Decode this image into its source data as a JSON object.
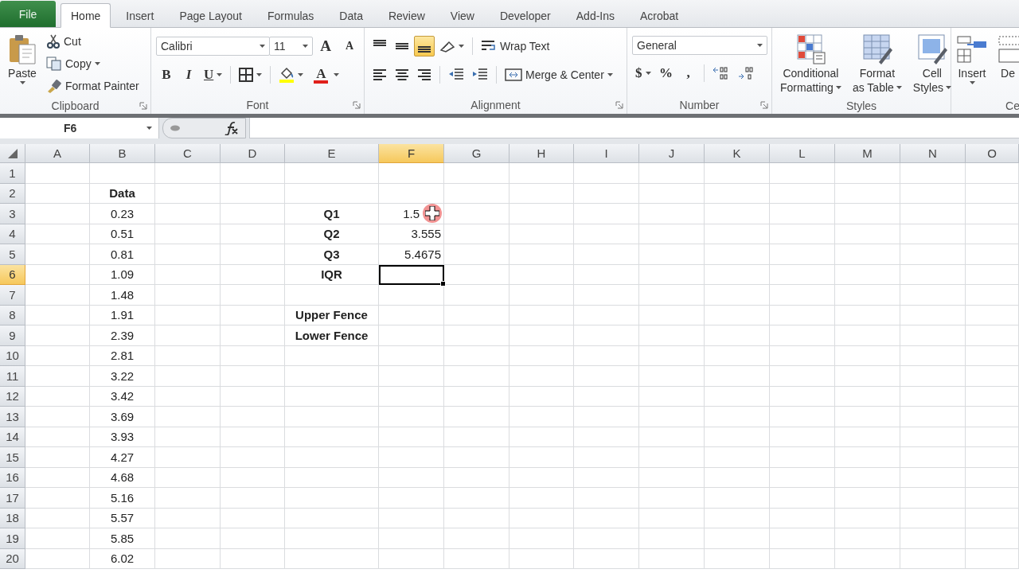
{
  "tabs": [
    {
      "label": "File",
      "kind": "file",
      "selected": false
    },
    {
      "label": "Home",
      "kind": "tab",
      "selected": true
    },
    {
      "label": "Insert",
      "kind": "tab",
      "selected": false
    },
    {
      "label": "Page Layout",
      "kind": "tab",
      "selected": false
    },
    {
      "label": "Formulas",
      "kind": "tab",
      "selected": false
    },
    {
      "label": "Data",
      "kind": "tab",
      "selected": false
    },
    {
      "label": "Review",
      "kind": "tab",
      "selected": false
    },
    {
      "label": "View",
      "kind": "tab",
      "selected": false
    },
    {
      "label": "Developer",
      "kind": "tab",
      "selected": false
    },
    {
      "label": "Add-Ins",
      "kind": "tab",
      "selected": false
    },
    {
      "label": "Acrobat",
      "kind": "tab",
      "selected": false
    }
  ],
  "ribbon": {
    "clipboard": {
      "label": "Clipboard",
      "paste": "Paste",
      "cut": "Cut",
      "copy": "Copy",
      "format_painter": "Format Painter"
    },
    "font": {
      "label": "Font",
      "font_name": "Calibri",
      "font_size": "11",
      "grow_glyph": "A",
      "shrink_glyph": "A",
      "bold_glyph": "B",
      "italic_glyph": "I",
      "underline_glyph": "U",
      "font_color_glyph": "A"
    },
    "alignment": {
      "label": "Alignment",
      "vertical": [
        {
          "kind": "top",
          "selected": false
        },
        {
          "kind": "middle",
          "selected": false
        },
        {
          "kind": "bottom",
          "selected": true
        }
      ],
      "horizontal": [
        {
          "kind": "left",
          "selected": false
        },
        {
          "kind": "center",
          "selected": false
        },
        {
          "kind": "right",
          "selected": false
        }
      ],
      "wrap_text": "Wrap Text",
      "merge_center": "Merge & Center"
    },
    "number": {
      "label": "Number",
      "format": "General",
      "currency": "$",
      "percent": "%",
      "comma": ","
    },
    "styles": {
      "label": "Styles",
      "buttons": [
        {
          "kind": "conditional",
          "lines": [
            "Conditional",
            "Formatting"
          ]
        },
        {
          "kind": "table",
          "lines": [
            "Format",
            "as Table"
          ]
        },
        {
          "kind": "cell",
          "lines": [
            "Cell",
            "Styles"
          ]
        }
      ]
    },
    "cells": {
      "label": "Ce",
      "buttons": [
        {
          "kind": "insert",
          "lines": [
            "Insert"
          ]
        },
        {
          "kind": "delete",
          "lines": [
            "De"
          ]
        }
      ]
    }
  },
  "name_box": "F6",
  "sheet": {
    "columns": [
      {
        "label": "A",
        "selected": false
      },
      {
        "label": "B",
        "selected": false
      },
      {
        "label": "C",
        "selected": false
      },
      {
        "label": "D",
        "selected": false
      },
      {
        "label": "E",
        "selected": false
      },
      {
        "label": "F",
        "selected": true
      },
      {
        "label": "G",
        "selected": false
      },
      {
        "label": "H",
        "selected": false
      },
      {
        "label": "I",
        "selected": false
      },
      {
        "label": "J",
        "selected": false
      },
      {
        "label": "K",
        "selected": false
      },
      {
        "label": "L",
        "selected": false
      },
      {
        "label": "M",
        "selected": false
      },
      {
        "label": "N",
        "selected": false
      },
      {
        "label": "O",
        "selected": false
      }
    ],
    "rows": [
      {
        "label": "1",
        "selected": false
      },
      {
        "label": "2",
        "selected": false,
        "cells": {
          "b": {
            "text": "Data",
            "bold": true,
            "selected": false
          }
        }
      },
      {
        "label": "3",
        "selected": false,
        "cells": {
          "b": {
            "text": "0.23",
            "bold": false,
            "selected": false
          },
          "e": {
            "text": "Q1",
            "bold": true,
            "selected": false
          },
          "f": {
            "text": "1.5",
            "bold": false,
            "selected": false,
            "pointer": true
          }
        }
      },
      {
        "label": "4",
        "selected": false,
        "cells": {
          "b": {
            "text": "0.51",
            "bold": false,
            "selected": false
          },
          "e": {
            "text": "Q2",
            "bold": true,
            "selected": false
          },
          "f": {
            "text": "3.555",
            "bold": false,
            "selected": false
          }
        }
      },
      {
        "label": "5",
        "selected": false,
        "cells": {
          "b": {
            "text": "0.81",
            "bold": false,
            "selected": false
          },
          "e": {
            "text": "Q3",
            "bold": true,
            "selected": false
          },
          "f": {
            "text": "5.4675",
            "bold": false,
            "selected": false
          }
        }
      },
      {
        "label": "6",
        "selected": true,
        "cells": {
          "b": {
            "text": "1.09",
            "bold": false,
            "selected": false
          },
          "e": {
            "text": "IQR",
            "bold": true,
            "selected": false
          },
          "f": {
            "selected": true
          }
        }
      },
      {
        "label": "7",
        "selected": false,
        "cells": {
          "b": {
            "text": "1.48",
            "bold": false,
            "selected": false
          }
        }
      },
      {
        "label": "8",
        "selected": false,
        "cells": {
          "b": {
            "text": "1.91",
            "bold": false,
            "selected": false
          },
          "e": {
            "text": "Upper Fence",
            "bold": true,
            "selected": false
          }
        }
      },
      {
        "label": "9",
        "selected": false,
        "cells": {
          "b": {
            "text": "2.39",
            "bold": false,
            "selected": false
          },
          "e": {
            "text": "Lower Fence",
            "bold": true,
            "selected": false
          }
        }
      },
      {
        "label": "10",
        "selected": false,
        "cells": {
          "b": {
            "text": "2.81",
            "bold": false,
            "selected": false
          }
        }
      },
      {
        "label": "11",
        "selected": false,
        "cells": {
          "b": {
            "text": "3.22",
            "bold": false,
            "selected": false
          }
        }
      },
      {
        "label": "12",
        "selected": false,
        "cells": {
          "b": {
            "text": "3.42",
            "bold": false,
            "selected": false
          }
        }
      },
      {
        "label": "13",
        "selected": false,
        "cells": {
          "b": {
            "text": "3.69",
            "bold": false,
            "selected": false
          }
        }
      },
      {
        "label": "14",
        "selected": false,
        "cells": {
          "b": {
            "text": "3.93",
            "bold": false,
            "selected": false
          }
        }
      },
      {
        "label": "15",
        "selected": false,
        "cells": {
          "b": {
            "text": "4.27",
            "bold": false,
            "selected": false
          }
        }
      },
      {
        "label": "16",
        "selected": false,
        "cells": {
          "b": {
            "text": "4.68",
            "bold": false,
            "selected": false
          }
        }
      },
      {
        "label": "17",
        "selected": false,
        "cells": {
          "b": {
            "text": "5.16",
            "bold": false,
            "selected": false
          }
        }
      },
      {
        "label": "18",
        "selected": false,
        "cells": {
          "b": {
            "text": "5.57",
            "bold": false,
            "selected": false
          }
        }
      },
      {
        "label": "19",
        "selected": false,
        "cells": {
          "b": {
            "text": "5.85",
            "bold": false,
            "selected": false
          }
        }
      },
      {
        "label": "20",
        "selected": false,
        "cells": {
          "b": {
            "text": "6.02",
            "bold": false,
            "selected": false
          }
        }
      }
    ]
  }
}
